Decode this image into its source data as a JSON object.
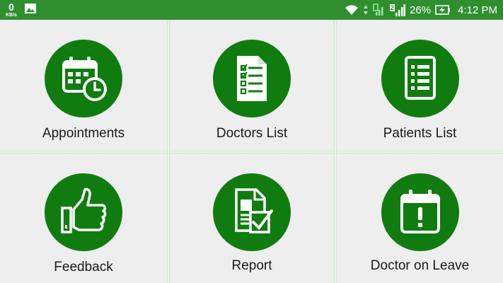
{
  "status_bar": {
    "net_speed_value": "0",
    "net_speed_unit": "KB/s",
    "sim_badge": "2",
    "battery_percent": "26%",
    "time": "4:12 PM",
    "icons": [
      "image-notification-icon",
      "wifi-icon",
      "data-arrows-icon",
      "signal-sim1-icon",
      "signal-sim2-icon",
      "battery-charging-icon"
    ]
  },
  "menu": {
    "items": [
      {
        "label": "Appointments",
        "icon": "calendar-clock-icon"
      },
      {
        "label": "Doctors List",
        "icon": "checklist-document-icon"
      },
      {
        "label": "Patients List",
        "icon": "list-document-icon"
      },
      {
        "label": "Feedback",
        "icon": "thumbs-up-icon"
      },
      {
        "label": "Report",
        "icon": "report-check-icon"
      },
      {
        "label": "Doctor on Leave",
        "icon": "calendar-alert-icon"
      }
    ]
  },
  "colors": {
    "status_bar": "#2f8f2f",
    "icon_circle": "#107c10",
    "tile_background": "#eeeeee"
  }
}
